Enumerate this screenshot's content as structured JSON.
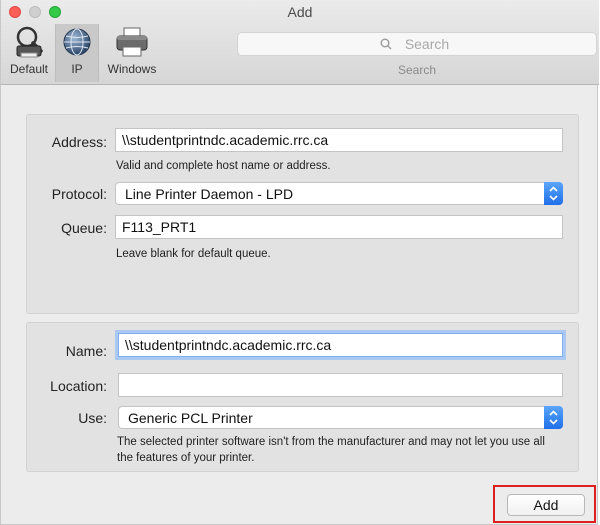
{
  "window": {
    "title": "Add"
  },
  "toolbar": {
    "items": [
      {
        "label": "Default",
        "icon": "default-printer-icon"
      },
      {
        "label": "IP",
        "icon": "globe-icon",
        "selected": true
      },
      {
        "label": "Windows",
        "icon": "windows-printer-icon"
      }
    ],
    "search": {
      "placeholder": "Search",
      "label": "Search"
    }
  },
  "connection": {
    "address": {
      "label": "Address:",
      "value": "\\\\studentprintndc.academic.rrc.ca",
      "hint": "Valid and complete host name or address."
    },
    "protocol": {
      "label": "Protocol:",
      "selected": "Line Printer Daemon - LPD"
    },
    "queue": {
      "label": "Queue:",
      "value": "F113_PRT1",
      "hint": "Leave blank for default queue."
    }
  },
  "details": {
    "name": {
      "label": "Name:",
      "value": "\\\\studentprintndc.academic.rrc.ca"
    },
    "location": {
      "label": "Location:",
      "value": ""
    },
    "use": {
      "label": "Use:",
      "selected": "Generic PCL Printer",
      "hint": "The selected printer software isn't from the manufacturer and may not let you use all the features of your printer."
    }
  },
  "actions": {
    "add_label": "Add"
  },
  "colors": {
    "accent": "#2a7af0",
    "highlight_box": "#e02020",
    "focus_ring": "#a9c9f3"
  }
}
